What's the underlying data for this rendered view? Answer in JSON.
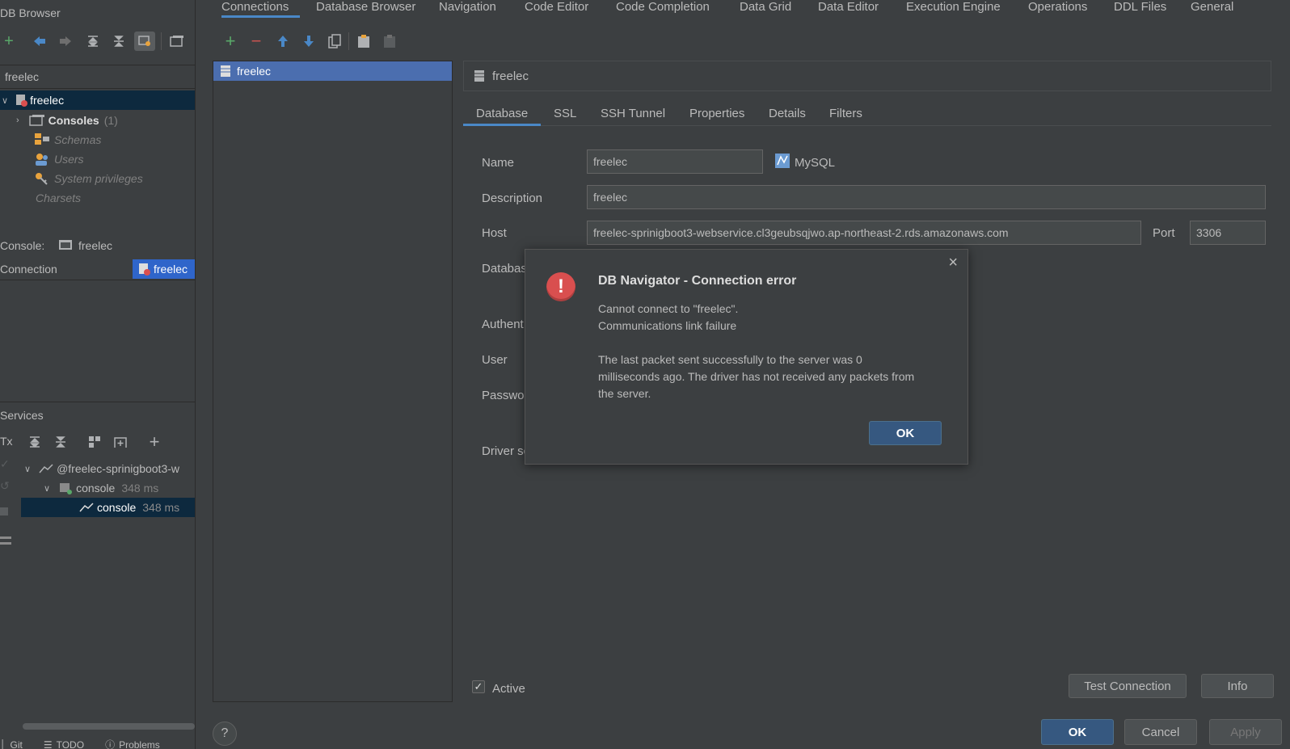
{
  "left": {
    "title": "DB Browser",
    "connection_filter": "freelec",
    "tree": {
      "root": "freelec",
      "consoles_label": "Consoles",
      "consoles_count": "(1)",
      "schemas": "Schemas",
      "users": "Users",
      "system_privileges": "System privileges",
      "charsets": "Charsets"
    },
    "console_label": "Console:",
    "console_value": "freelec",
    "connection_label": "Connection",
    "connection_value": "freelec",
    "services_title": "Services",
    "tx_label": "Tx",
    "services_tree": {
      "root": "@freelec-sprinigboot3-w",
      "console_group": "console",
      "console_group_time": "348 ms",
      "console_item": "console",
      "console_item_time": "348 ms"
    },
    "bottom_tabs": [
      "Git",
      "TODO",
      "Problems"
    ]
  },
  "settings": {
    "tabs": [
      "Connections",
      "Database Browser",
      "Navigation",
      "Code Editor",
      "Code Completion",
      "Data Grid",
      "Data Editor",
      "Execution Engine",
      "Operations",
      "DDL Files",
      "General"
    ],
    "connection_list": [
      "freelec"
    ],
    "header_name": "freelec",
    "sub_tabs": [
      "Database",
      "SSL",
      "SSH Tunnel",
      "Properties",
      "Details",
      "Filters"
    ],
    "form": {
      "name_label": "Name",
      "name_value": "freelec",
      "db_type": "MySQL",
      "description_label": "Description",
      "description_value": "freelec",
      "host_label": "Host",
      "host_value": "freelec-sprinigboot3-webservice.cl3geubsqjwo.ap-northeast-2.rds.amazonaws.com",
      "port_label": "Port",
      "port_value": "3306",
      "database_label": "Databas",
      "auth_label": "Authent",
      "user_label": "User",
      "password_label": "Passwor",
      "driver_label": "Driver sc"
    },
    "active_label": "Active",
    "test_connection": "Test Connection",
    "info": "Info",
    "ok": "OK",
    "cancel": "Cancel",
    "apply": "Apply",
    "help": "?"
  },
  "dialog": {
    "title": "DB Navigator - Connection error",
    "line1": "Cannot connect to \"freelec\".",
    "line2": "Communications link failure",
    "para1": "The last packet sent successfully to the server was 0",
    "para2": "milliseconds ago. The driver has not received any packets from",
    "para3": "the server.",
    "ok": "OK"
  },
  "colors": {
    "accent": "#4a88c7",
    "selection": "#4b6eaf",
    "error": "#d94f4f",
    "add": "#59a869",
    "remove": "#c75450"
  }
}
